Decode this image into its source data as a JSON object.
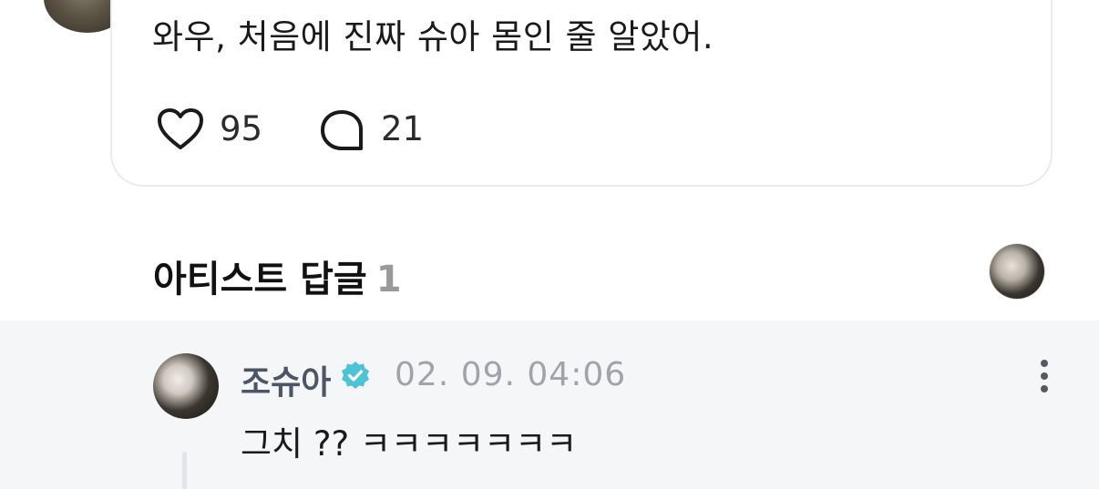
{
  "post": {
    "text": "와우, 처음에 진짜 슈아 몸인 줄 알았어.",
    "likes": "95",
    "comments": "21"
  },
  "artist_replies": {
    "title": "아티스트 답글",
    "count": "1"
  },
  "reply": {
    "author": "조슈아",
    "timestamp": "02. 09. 04:06",
    "text": "그치 ?? ㅋㅋㅋㅋㅋㅋㅋ"
  },
  "colors": {
    "verified": "#4dc3d8",
    "reply_background": "#f5f6f8",
    "author_name": "#4c5666"
  },
  "icons": {
    "like": "heart-outline-icon",
    "comment": "speech-bubble-icon",
    "verified": "verified-badge-icon",
    "more": "vertical-dots-icon"
  }
}
